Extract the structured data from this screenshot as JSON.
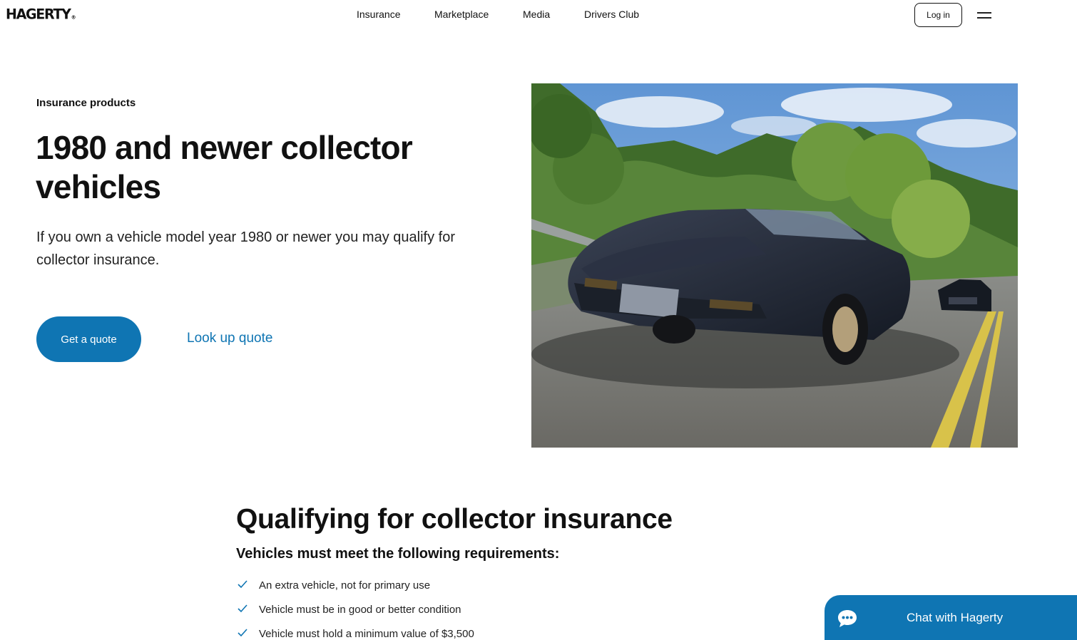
{
  "brand": {
    "logo": "HAGERTY",
    "mark": "®",
    "accent_color": "#0f75b3"
  },
  "nav": {
    "items": [
      {
        "label": "Insurance"
      },
      {
        "label": "Marketplace"
      },
      {
        "label": "Media"
      },
      {
        "label": "Drivers Club"
      }
    ],
    "login_label": "Log in",
    "menu_icon": "hamburger-icon"
  },
  "hero": {
    "eyebrow": "Insurance products",
    "title": "1980 and newer collector vehicles",
    "description": "If you own a vehicle model year 1980 or newer you may qualify for collector insurance.",
    "primary_cta": "Get a quote",
    "secondary_cta": "Look up quote",
    "image": "black-corvette-on-road-photo"
  },
  "qualifying": {
    "title": "Qualifying for collector insurance",
    "subtitle": "Vehicles must meet the following requirements:",
    "requirements": [
      "An extra vehicle, not for primary use",
      "Vehicle must be in good or better condition",
      "Vehicle must hold a minimum value of $3,500"
    ],
    "check_icon": "checkmark-icon"
  },
  "chat": {
    "label": "Chat with Hagerty",
    "icon": "chat-bubble-icon"
  }
}
